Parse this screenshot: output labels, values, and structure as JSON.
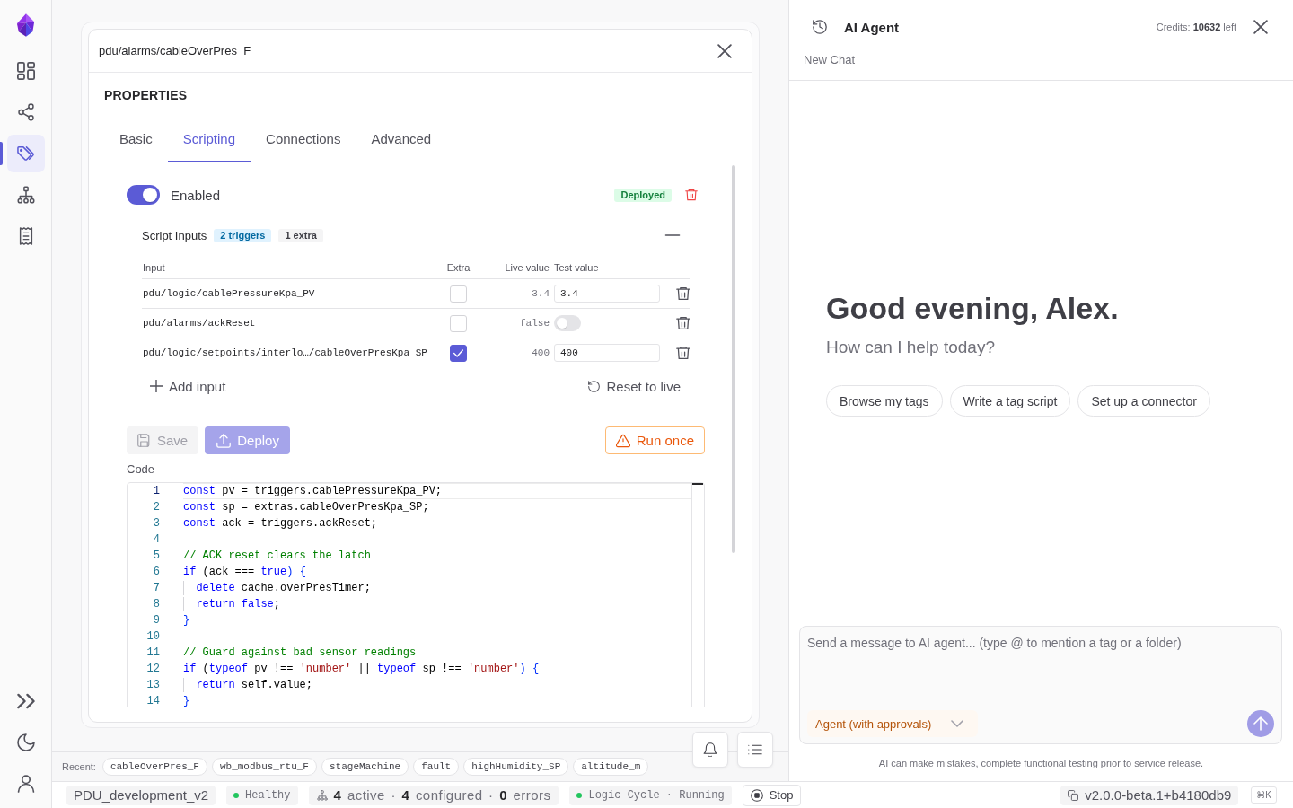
{
  "sidebar": {
    "nav_items": [
      {
        "selected": false
      },
      {
        "selected": false
      },
      {
        "selected": true
      },
      {
        "selected": false
      },
      {
        "selected": false
      }
    ]
  },
  "tag_panel": {
    "path": "pdu/alarms/cableOverPres_F",
    "section": "PROPERTIES",
    "tabs": [
      {
        "label": "Basic",
        "selected": false
      },
      {
        "label": "Scripting",
        "selected": true
      },
      {
        "label": "Connections",
        "selected": false
      },
      {
        "label": "Advanced",
        "selected": false
      }
    ],
    "script": {
      "enabled": {
        "label": "Enabled",
        "on": true
      },
      "status": "Deployed",
      "inputs": {
        "title": "Script Inputs",
        "expanded": true,
        "badges": [
          {
            "kind": "triggers",
            "text": "2 triggers"
          },
          {
            "kind": "extras",
            "text": "1 extra"
          }
        ],
        "columns": [
          "Input",
          "Extra",
          "Live value",
          "Test value"
        ],
        "rows": [
          {
            "kind": "text",
            "input": "pdu/logic/cablePressureKpa_PV",
            "extra": false,
            "live_value": "3.4",
            "test_value": "3.4"
          },
          {
            "kind": "toggle",
            "input": "pdu/alarms/ackReset",
            "extra": false,
            "live_value": "false",
            "test_on": false
          },
          {
            "kind": "text",
            "input": "pdu/logic/setpoints/interlo…/cableOverPresKpa_SP",
            "extra": true,
            "live_value": "400",
            "test_value": "400"
          }
        ],
        "add_label": "Add input",
        "reset_label": "Reset to live"
      },
      "save": {
        "label": "Save",
        "disabled": true
      },
      "deploy": {
        "label": "Deploy",
        "disabled": true
      },
      "run_once": {
        "label": "Run once"
      },
      "code": {
        "label": "Code",
        "lines": [
          {
            "number": "1",
            "active": true,
            "tokens": [
              {
                "kind": "keyword",
                "text": "const"
              },
              {
                "kind": "plain",
                "text": " pv = triggers.cablePressureKpa_PV;"
              }
            ]
          },
          {
            "number": "2",
            "active": false,
            "tokens": [
              {
                "kind": "keyword",
                "text": "const"
              },
              {
                "kind": "plain",
                "text": " sp = extras.cableOverPresKpa_SP;"
              }
            ]
          },
          {
            "number": "3",
            "active": false,
            "tokens": [
              {
                "kind": "keyword",
                "text": "const"
              },
              {
                "kind": "plain",
                "text": " ack = triggers.ackReset;"
              }
            ]
          },
          {
            "number": "4",
            "active": false
          },
          {
            "number": "5",
            "active": false,
            "tokens": [
              {
                "kind": "comment",
                "text": "// ACK reset clears the latch"
              }
            ]
          },
          {
            "number": "6",
            "active": false,
            "tokens": [
              {
                "kind": "keyword",
                "text": "if"
              },
              {
                "kind": "plain",
                "text": " (ack === "
              },
              {
                "kind": "keyword",
                "text": "true"
              },
              {
                "kind": "bracket",
                "text": ") {"
              }
            ],
            "children": [
              {
                "number": "7",
                "active": false,
                "tokens": [
                  {
                    "kind": "keyword",
                    "text": "delete"
                  },
                  {
                    "kind": "plain",
                    "text": " cache.overPresTimer;"
                  }
                ]
              },
              {
                "number": "8",
                "active": false,
                "tokens": [
                  {
                    "kind": "keyword",
                    "text": "return"
                  },
                  {
                    "kind": "keyword",
                    "text": " false"
                  },
                  {
                    "kind": "plain",
                    "text": ";"
                  }
                ]
              }
            ]
          },
          {
            "number": "9",
            "active": false,
            "tokens": [
              {
                "kind": "bracket",
                "text": "}"
              }
            ]
          },
          {
            "number": "10",
            "active": false
          },
          {
            "number": "11",
            "active": false,
            "tokens": [
              {
                "kind": "comment",
                "text": "// Guard against bad sensor readings"
              }
            ]
          },
          {
            "number": "12",
            "active": false,
            "tokens": [
              {
                "kind": "keyword",
                "text": "if"
              },
              {
                "kind": "plain",
                "text": " ("
              },
              {
                "kind": "keyword",
                "text": "typeof"
              },
              {
                "kind": "plain",
                "text": " pv !== "
              },
              {
                "kind": "string",
                "text": "'number'"
              },
              {
                "kind": "plain",
                "text": " || "
              },
              {
                "kind": "keyword",
                "text": "typeof"
              },
              {
                "kind": "plain",
                "text": " sp !== "
              },
              {
                "kind": "string",
                "text": "'number'"
              },
              {
                "kind": "bracket",
                "text": ") {"
              }
            ],
            "children": [
              {
                "number": "13",
                "active": false,
                "tokens": [
                  {
                    "kind": "keyword",
                    "text": "return"
                  },
                  {
                    "kind": "plain",
                    "text": " self.value;"
                  }
                ]
              }
            ]
          },
          {
            "number": "14",
            "active": false,
            "tokens": [
              {
                "kind": "bracket",
                "text": "}"
              }
            ]
          }
        ]
      }
    }
  },
  "recent": {
    "label": "Recent:",
    "items": [
      "cableOverPres_F",
      "wb_modbus_rtu_F",
      "stageMachine",
      "fault",
      "highHumidity_SP",
      "altitude_m"
    ]
  },
  "status_bar": {
    "project": "PDU_development_v2",
    "health": "Healthy",
    "connectors": "**4** active · **4** configured · **0** errors",
    "logic_cycle": "Logic Cycle · Running",
    "stop": "Stop",
    "version": "v2.0.0-beta.1+b4180db9",
    "shortcut": "⌘K"
  },
  "ai_agent": {
    "title": "AI Agent",
    "credits": "Credits: **10632** left",
    "chat_title": "New Chat",
    "greeting": "Good evening, Alex.",
    "prompt": "How can I help today?",
    "suggestions": [
      "Browse my tags",
      "Write a tag script",
      "Set up a connector"
    ],
    "composer": {
      "placeholder": "Send a message to AI agent... (type @ to mention a tag or a folder)",
      "mode": "Agent (with approvals)"
    },
    "disclaimer": "AI can make mistakes, complete functional testing prior to service release."
  }
}
